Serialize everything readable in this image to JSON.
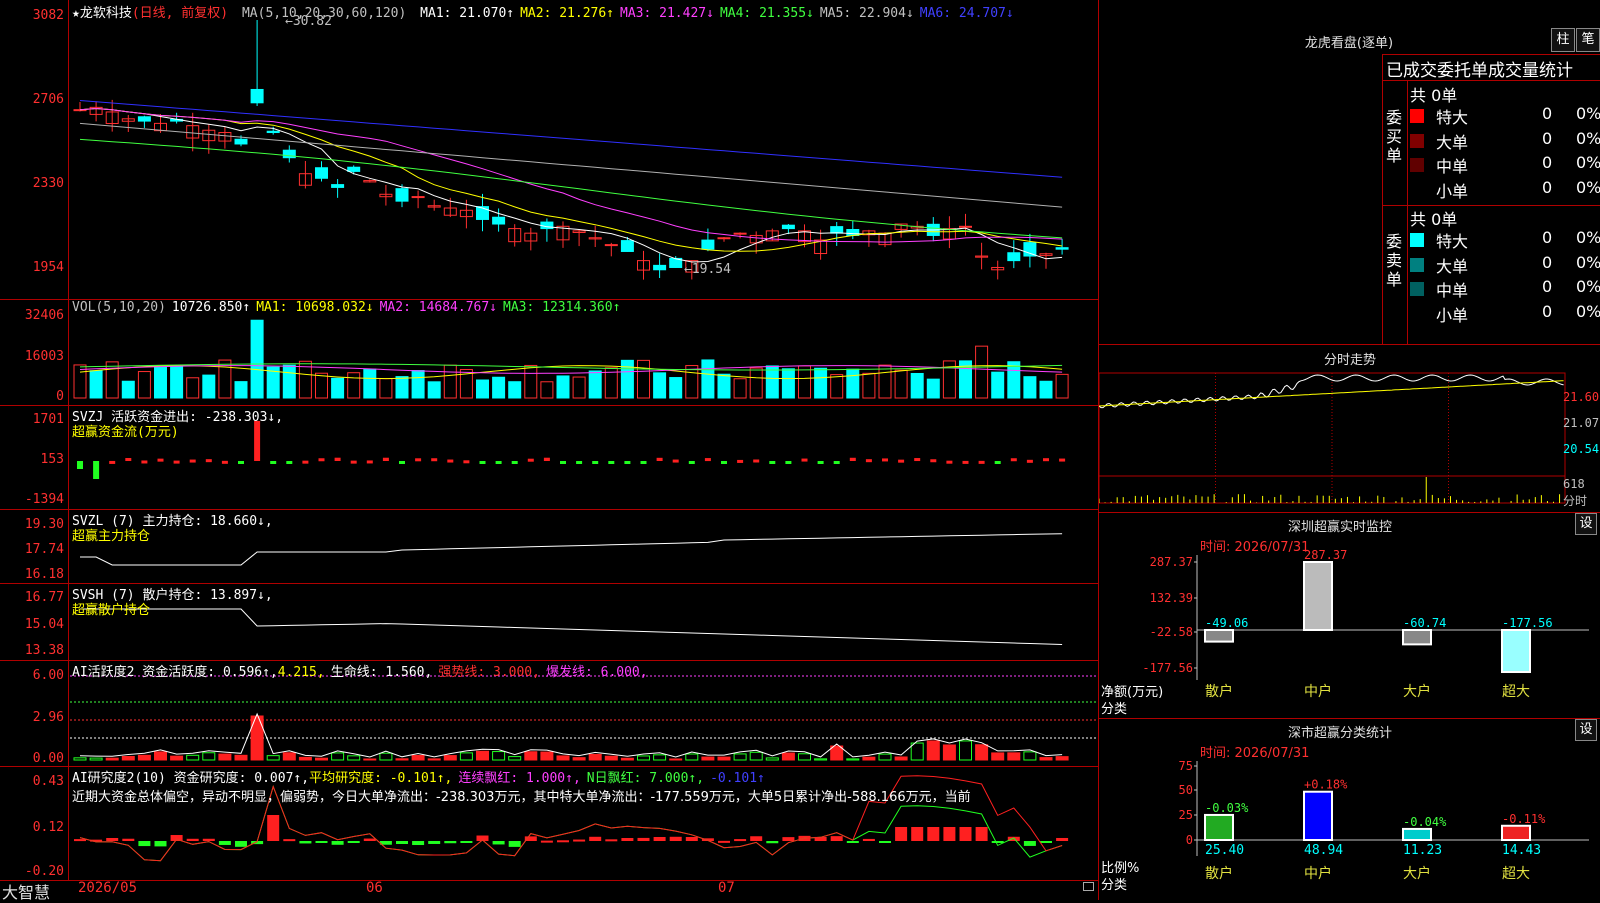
{
  "stock": {
    "name": "★龙软科技",
    "period": "(日线, 前复权)"
  },
  "main": {
    "ma_legend": "MA(5,10,20,30,60,120)",
    "ma_items": [
      {
        "label": "MA1: 21.070↑",
        "color": "#ffffff"
      },
      {
        "label": "MA2: 21.276↑",
        "color": "#ffff00"
      },
      {
        "label": "MA3: 21.427↓",
        "color": "#ff40ff"
      },
      {
        "label": "MA4: 21.355↓",
        "color": "#40ff40"
      },
      {
        "label": "MA5: 22.904↓",
        "color": "#c0c0c0"
      },
      {
        "label": "MA6: 24.707↓",
        "color": "#4040ff"
      }
    ],
    "yticks": [
      "3082",
      "2706",
      "2330",
      "1954"
    ],
    "high_mark": "30.82",
    "low_mark": "←19.54"
  },
  "vol": {
    "legend": "VOL(5,10,20)",
    "value": "10726.850↑",
    "items": [
      {
        "label": "MA1: 10698.032↓",
        "color": "#ffff00"
      },
      {
        "label": "MA2: 14684.767↓",
        "color": "#ff40ff"
      },
      {
        "label": "MA3: 12314.360↑",
        "color": "#40ff40"
      }
    ],
    "yticks": [
      "32406",
      "16003",
      "0"
    ]
  },
  "svzj": {
    "legend": "SVZJ  活跃资金进出: -238.303↓,",
    "sub": "超赢资金流(万元)",
    "yticks": [
      "1701",
      "153",
      "-1394"
    ]
  },
  "svzl": {
    "legend": "SVZL (7) 主力持仓: 18.660↓,",
    "sub": "超赢主力持仓",
    "yticks": [
      "19.30",
      "17.74",
      "16.18"
    ]
  },
  "svsh": {
    "legend": "SVSH (7) 散户持仓: 13.897↓,",
    "sub": "超赢散户持仓",
    "yticks": [
      "16.77",
      "15.04",
      "13.38"
    ]
  },
  "ai1": {
    "legend": "AI活跃度2 资金活跃度: 0.596↑,",
    "v2": "4.215,",
    "v3": "生命线: 1.560,",
    "v4": "强势线: 3.000,",
    "v5": "爆发线: 6.000,",
    "yticks": [
      "6.00",
      "2.96",
      "0.00"
    ]
  },
  "ai2": {
    "legend": "AI研究度2(10) 资金研究度: 0.007↑,",
    "v2": "平均研究度: -0.101↑,",
    "v3": "连续飘红: 1.000↑,",
    "v4": "N日飘红: 7.000↑,",
    "v5": "-0.101↑",
    "text": "近期大资金总体偏空，异动不明显，偏弱势，今日大单净流出：-238.303万元，其中特大单净流出：-177.559万元，大单5日累计净出-588.166万元，当前",
    "yticks": [
      "0.43",
      "0.12",
      "-0.20"
    ]
  },
  "xaxis": {
    "logo": "大智慧",
    "labels": [
      "2026/05",
      "06",
      "07"
    ]
  },
  "longhu": {
    "title": "龙虎看盘(逐单)",
    "btn1": "柱",
    "btn2": "笔",
    "header": "已成交委托单成交量统计",
    "buy": {
      "side": "委买单",
      "count": "共 0单",
      "rows": [
        {
          "name": "特大",
          "v": "0",
          "p": "0%",
          "c": "#ff0000"
        },
        {
          "name": "大单",
          "v": "0",
          "p": "0%",
          "c": "#800000"
        },
        {
          "name": "中单",
          "v": "0",
          "p": "0%",
          "c": "#600000"
        },
        {
          "name": "小单",
          "v": "0",
          "p": "0%",
          "c": "#000000"
        }
      ]
    },
    "sell": {
      "side": "委卖单",
      "count": "共 0单",
      "rows": [
        {
          "name": "特大",
          "v": "0",
          "p": "0%",
          "c": "#00ffff"
        },
        {
          "name": "大单",
          "v": "0",
          "p": "0%",
          "c": "#008080"
        },
        {
          "name": "中单",
          "v": "0",
          "p": "0%",
          "c": "#006060"
        },
        {
          "name": "小单",
          "v": "0",
          "p": "0%",
          "c": "#000000"
        }
      ]
    }
  },
  "intraday": {
    "title": "分时走势",
    "yticks": [
      "21.60",
      "21.07",
      "20.54"
    ],
    "vol_tick": "618",
    "vol_label": "分时"
  },
  "monitor": {
    "title": "深圳超赢实时监控",
    "btn": "设",
    "time": "时间: 2026/07/31",
    "yticks": [
      "287.37",
      "132.39",
      "-22.58",
      "-177.56"
    ],
    "ylabel": "净额(万元)",
    "cat_title": "分类",
    "chart_data": {
      "type": "bar",
      "categories": [
        "散户",
        "中户",
        "大户",
        "超大"
      ],
      "values": [
        -49.06,
        287.37,
        -60.74,
        -177.56
      ],
      "ylim": [
        -177.56,
        287.37
      ],
      "labels": [
        "-49.06",
        "287.37",
        "-60.74",
        "-177.56"
      ]
    }
  },
  "stats": {
    "title": "深市超赢分类统计",
    "btn": "设",
    "time": "时间: 2026/07/31",
    "yticks": [
      "75",
      "50",
      "25",
      "0"
    ],
    "ylabel": "比例%",
    "cat_title": "分类",
    "chart_data": {
      "type": "bar",
      "categories": [
        "散户",
        "中户",
        "大户",
        "超大"
      ],
      "values": [
        25.4,
        48.94,
        11.23,
        14.43
      ],
      "changes": [
        "-0.03%",
        "+0.18%",
        "-0.04%",
        "-0.11%"
      ],
      "values_text": [
        "25.40",
        "48.94",
        "11.23",
        "14.43"
      ],
      "ylim": [
        0,
        75
      ]
    }
  }
}
